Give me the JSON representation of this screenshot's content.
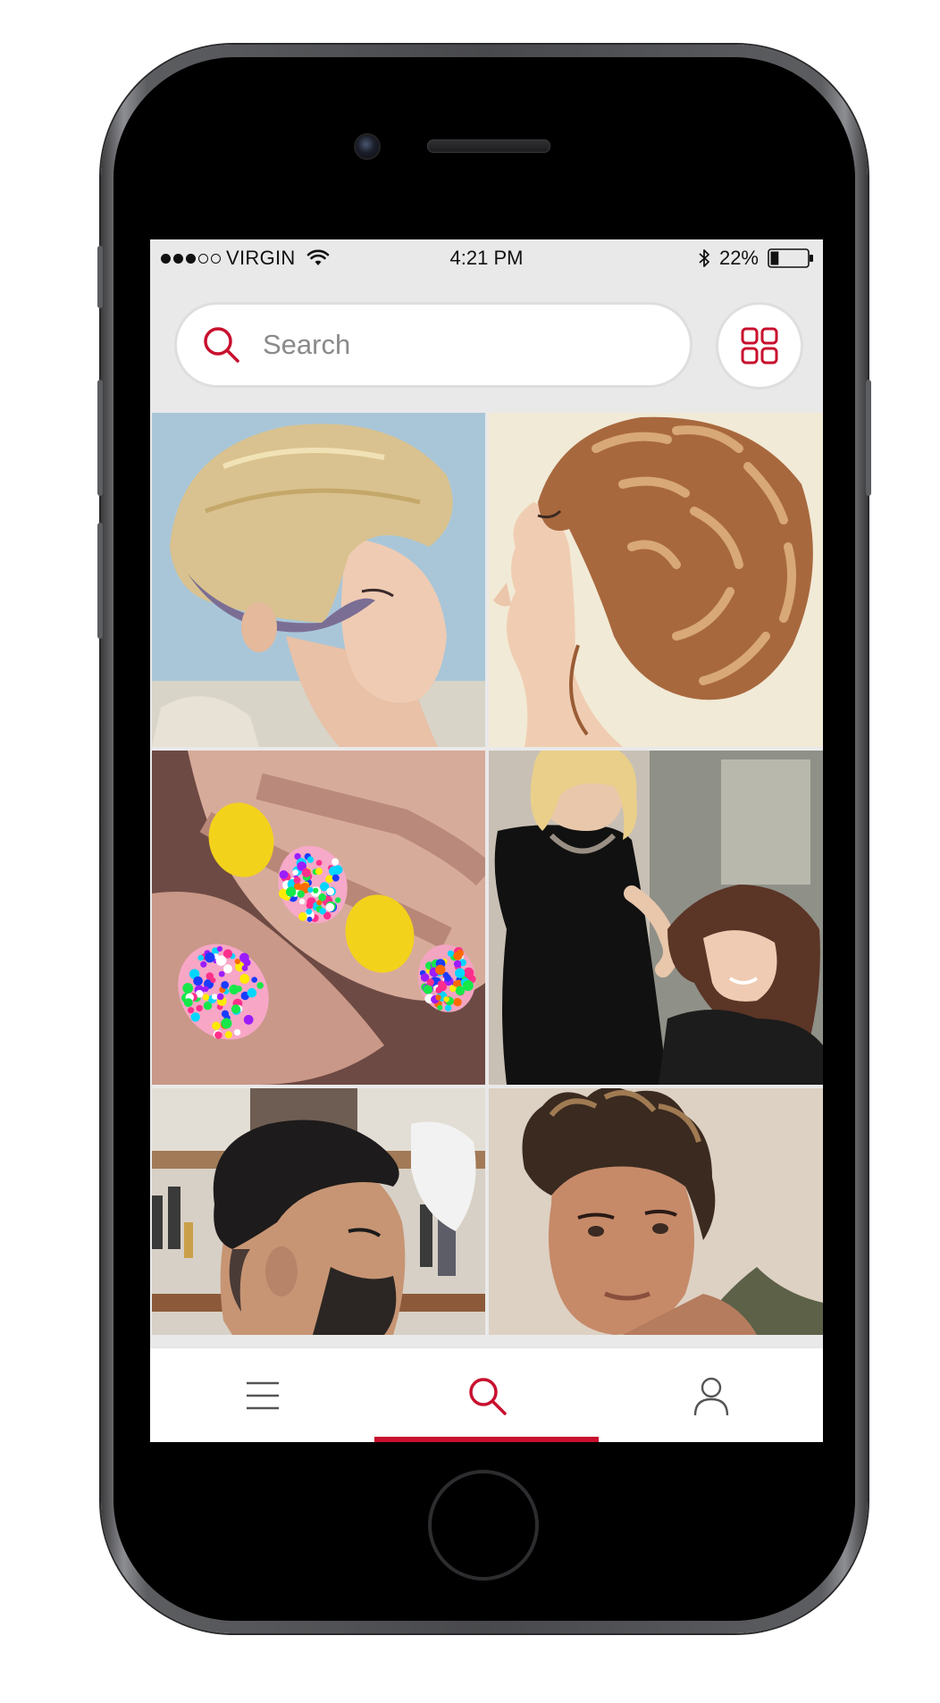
{
  "device": "iPhone",
  "status_bar": {
    "carrier": "VIRGIN",
    "time": "4:21 PM",
    "battery": "22%",
    "battery_level": 0.22,
    "signal_bars_filled": 3,
    "signal_bars_total": 5
  },
  "search": {
    "placeholder": "Search",
    "icon": "search-icon"
  },
  "grid_toggle": {
    "icon": "grid-icon"
  },
  "photos": [
    {
      "subject": "blonde-short-haircut"
    },
    {
      "subject": "braided-updo"
    },
    {
      "subject": "polka-dot-nails"
    },
    {
      "subject": "stylist-with-client"
    },
    {
      "subject": "men-pompadour-fade"
    },
    {
      "subject": "men-spiky-hair"
    }
  ],
  "tab_bar": {
    "tabs": [
      {
        "icon": "menu-icon",
        "active": false
      },
      {
        "icon": "search-icon",
        "active": true
      },
      {
        "icon": "user-icon",
        "active": false
      }
    ]
  },
  "colors": {
    "accent": "#c8102e",
    "screen_bg": "#e9e9e9",
    "tab_bg": "#ffffff",
    "icon_gray": "#555555"
  }
}
